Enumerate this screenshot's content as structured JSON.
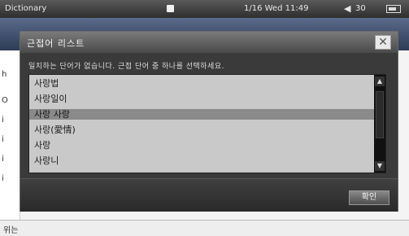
{
  "statusbar": {
    "app_title": "Dictionary",
    "datetime": "1/16 Wed 11:49",
    "volume": "30",
    "speaker_icon": "speaker-icon",
    "battery_icon": "battery-icon"
  },
  "background": {
    "left_chars": [
      "h",
      "O",
      "i",
      "i",
      "i",
      "i"
    ],
    "bottom_text": "위는"
  },
  "dialog": {
    "title": "근접어 리스트",
    "close_label": "✕",
    "message": "일치하는 단어가 없습니다. 근접 단어 중 하나를 선택하세요.",
    "items": [
      {
        "label": "사랑법",
        "selected": false
      },
      {
        "label": "사랑일이",
        "selected": false
      },
      {
        "label": "사랑 사랑",
        "selected": true
      },
      {
        "label": "사랑(愛情)",
        "selected": false
      },
      {
        "label": "사랑",
        "selected": false
      },
      {
        "label": "사랑니",
        "selected": false
      }
    ],
    "scroll_up": "▲",
    "scroll_down": "▼",
    "ok_label": "확인"
  }
}
